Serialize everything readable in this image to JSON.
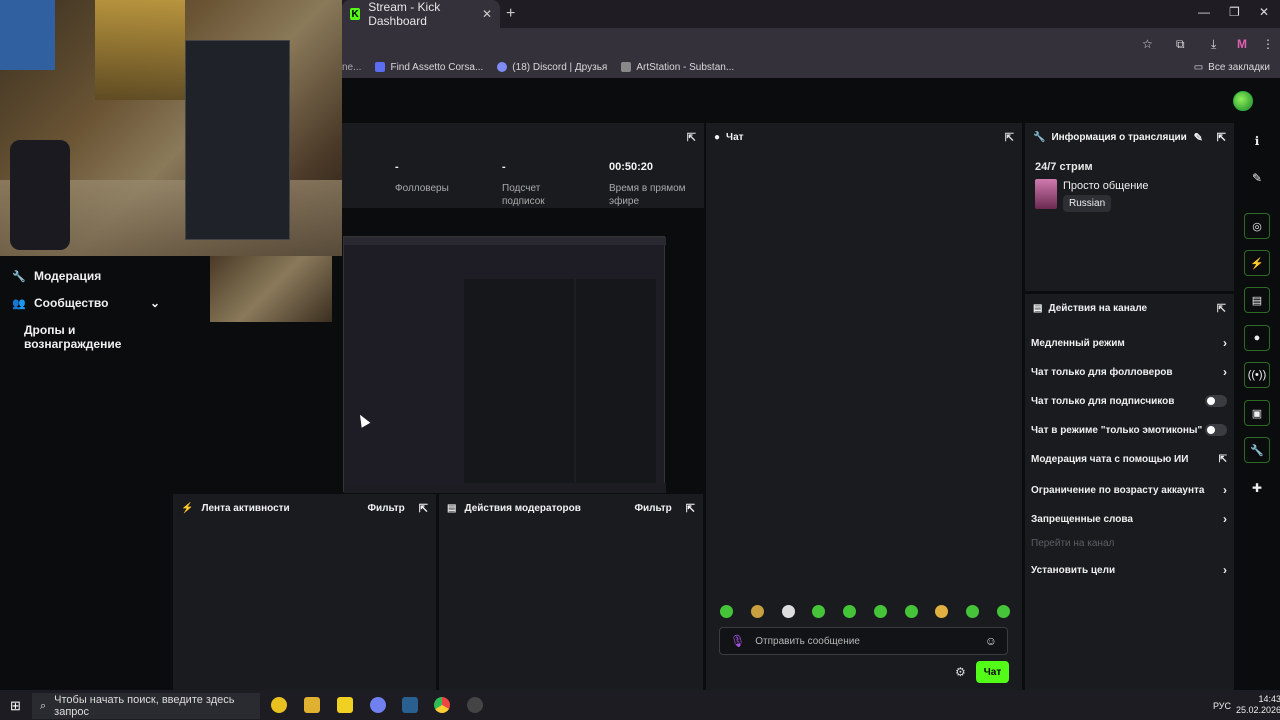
{
  "browser": {
    "tab_title": "Stream - Kick Dashboard",
    "favicon": "K",
    "bookmarks": [
      {
        "label": "Find Assetto Corsa...",
        "color": "#5b6cf0"
      },
      {
        "label": "(18) Discord | Друзья",
        "color": "#7e8cf5"
      },
      {
        "label": "ArtStation - Substan...",
        "color": "#888888"
      }
    ],
    "all_bookmarks": "Все закладки",
    "profile_letter": "M"
  },
  "sidebar": {
    "items": [
      {
        "label": "Модерация",
        "icon": "wrench-icon"
      },
      {
        "label": "Сообщество",
        "icon": "users-icon"
      },
      {
        "label": "Дропы и вознаграждение",
        "icon": ""
      }
    ]
  },
  "stats": [
    {
      "value": "-",
      "label": "Фолловеры"
    },
    {
      "value": "-",
      "label": "Подсчет подписок"
    },
    {
      "value": "00:50:20",
      "label": "Время в прямом эфире"
    }
  ],
  "panels": {
    "activity": {
      "title": "Лента активности",
      "filter": "Фильтр"
    },
    "modactions": {
      "title": "Действия модераторов",
      "filter": "Фильтр"
    },
    "chat": {
      "title": "Чат"
    }
  },
  "chat": {
    "placeholder": "Отправить сообщение",
    "send_label": "Чат"
  },
  "info": {
    "header": "Информация о трансляции",
    "title": "24/7 стрим",
    "category": "Просто общение",
    "language": "Russian"
  },
  "actions": {
    "header": "Действия на канале",
    "items": [
      {
        "label": "Медленный режим",
        "control": "arrow"
      },
      {
        "label": "Чат только для фолловеров",
        "control": "arrow"
      },
      {
        "label": "Чат только для подписчиков",
        "control": "toggle"
      },
      {
        "label": "Чат в режиме \"только эмотиконы\"",
        "control": "toggle"
      },
      {
        "label": "Модерация чата с помощью ИИ",
        "control": "external"
      },
      {
        "label": "Ограничение по возрасту аккаунта",
        "control": "arrow"
      },
      {
        "label": "Запрещенные слова",
        "control": "arrow"
      },
      {
        "label": "Перейти на канал",
        "control": "none"
      },
      {
        "label": "Установить цели",
        "control": "arrow"
      }
    ]
  },
  "taskbar": {
    "search_placeholder": "Чтобы начать поиск, введите здесь запрос",
    "lang": "РУС",
    "time": "14:43",
    "date": "25.02.2026"
  },
  "colors": {
    "accent": "#53fc18",
    "panel": "#191b1f",
    "background": "#0b0c0e"
  }
}
